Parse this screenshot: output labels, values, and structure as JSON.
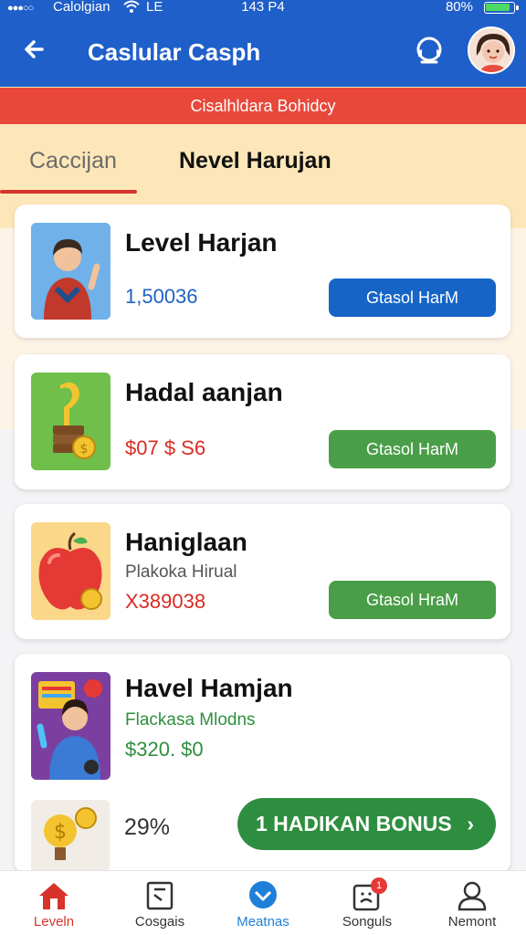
{
  "status_bar": {
    "dots": "●●●○○",
    "carrier": "Calolgian",
    "network": "LE",
    "time": "143 P4",
    "battery_pct": "80%"
  },
  "header": {
    "title": "Caslular Casph",
    "back_icon": "back-arrow-icon",
    "support_icon": "headset-icon"
  },
  "banner": {
    "text": "Cisalhldara Bohidcy"
  },
  "tabs": [
    {
      "label": "Caccijan",
      "active": true
    },
    {
      "label": "Nevel Harujan",
      "active": false
    }
  ],
  "cards": [
    {
      "title": "Level Harjan",
      "value": "1,50036",
      "value_color": "#1d62c4",
      "button": "Gtasol HarM",
      "button_color": "#1665c6"
    },
    {
      "title": "Hadal aanjan",
      "value": "$07 $ S6",
      "value_color": "#d92b23",
      "button": "Gtasol HarM",
      "button_color": "#4a9e48"
    },
    {
      "title": "Haniglaan",
      "subtitle": "Plakoka Hirual",
      "value": "X389038",
      "value_color": "#d92b23",
      "button": "Gtasol HraM",
      "button_color": "#4a9e48"
    },
    {
      "title": "Havel Hamjan",
      "subtitle": "Flackasa Mlodns",
      "value": "$320. $0",
      "value_color": "#2e8e3f"
    }
  ],
  "bonus": {
    "percent": "29%",
    "button": "1 HADIKAN BONUS",
    "chevron": "›"
  },
  "bottom_nav": [
    {
      "label": "Leveln",
      "icon": "home-icon",
      "color": "#d6342b"
    },
    {
      "label": "Cosgais",
      "icon": "book-icon",
      "color": "#333333"
    },
    {
      "label": "Meatnas",
      "icon": "chat-icon",
      "color": "#1f7fd8"
    },
    {
      "label": "Songuls",
      "icon": "notification-icon",
      "badge": "1",
      "color": "#333333"
    },
    {
      "label": "Nemont",
      "icon": "profile-icon",
      "color": "#333333"
    }
  ]
}
